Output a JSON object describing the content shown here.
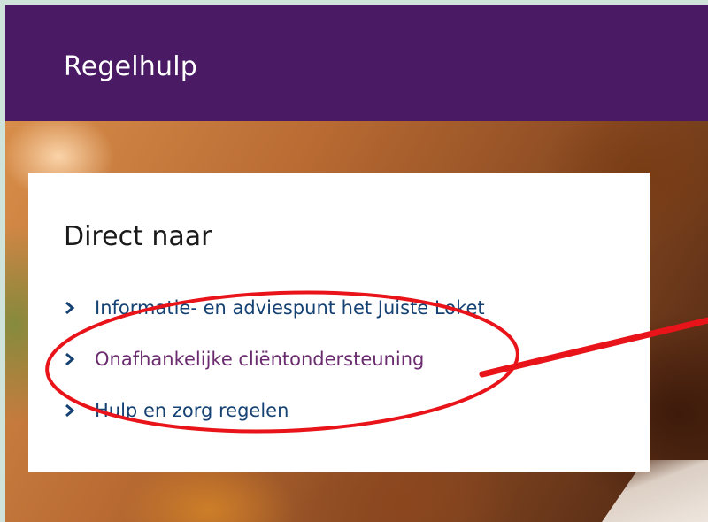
{
  "header": {
    "title": "Regelhulp"
  },
  "card": {
    "title": "Direct naar",
    "links": [
      {
        "label": "Informatie- en adviespunt het Juiste Loket",
        "icon": "chevron-right-icon",
        "state": "default"
      },
      {
        "label": "Onafhankelijke cliëntondersteuning",
        "icon": "chevron-right-icon",
        "state": "visited"
      },
      {
        "label": "Hulp en zorg regelen",
        "icon": "chevron-right-icon",
        "state": "default"
      }
    ]
  },
  "colors": {
    "header_bg": "#4a1a64",
    "link": "#154273",
    "link_visited": "#6a2c6e",
    "annotation": "#e8141a",
    "frame_bg": "#cfe3da"
  }
}
